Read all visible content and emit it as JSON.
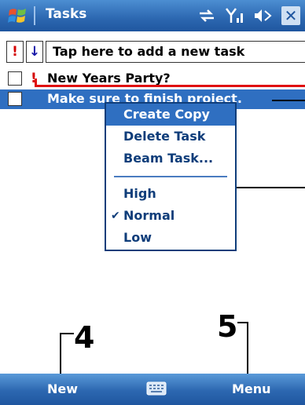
{
  "app": {
    "title": "Tasks"
  },
  "status_icons": {
    "sync": "sync-icon",
    "signal": "signal-icon",
    "volume": "volume-icon",
    "close": "close-icon",
    "close_glyph": "✕"
  },
  "toolbar": {
    "priority_glyph": "!",
    "sort_glyph": "↓",
    "new_task_placeholder": "Tap here to add a new task"
  },
  "tasks": [
    {
      "text": "New Years Party?",
      "priority": "high",
      "priority_glyph": "!",
      "selected": false
    },
    {
      "text": "Make sure to finish project.",
      "priority": "normal",
      "selected": true
    }
  ],
  "context_menu": {
    "items": [
      {
        "label": "Create Copy",
        "selected": true
      },
      {
        "label": "Delete Task"
      },
      {
        "label": "Beam Task..."
      },
      {
        "label": "High"
      },
      {
        "label": "Normal",
        "checked": true,
        "check_glyph": "✔"
      },
      {
        "label": "Low"
      }
    ]
  },
  "callouts": {
    "left_number": "4",
    "right_number": "5"
  },
  "softkeys": {
    "left": "New",
    "right": "Menu",
    "keyboard": "keyboard-icon"
  },
  "colors": {
    "accent": "#2f6fc1",
    "title_bar": "#2c67b0",
    "priority_red": "#d40000",
    "menu_text": "#0f3d7a"
  }
}
